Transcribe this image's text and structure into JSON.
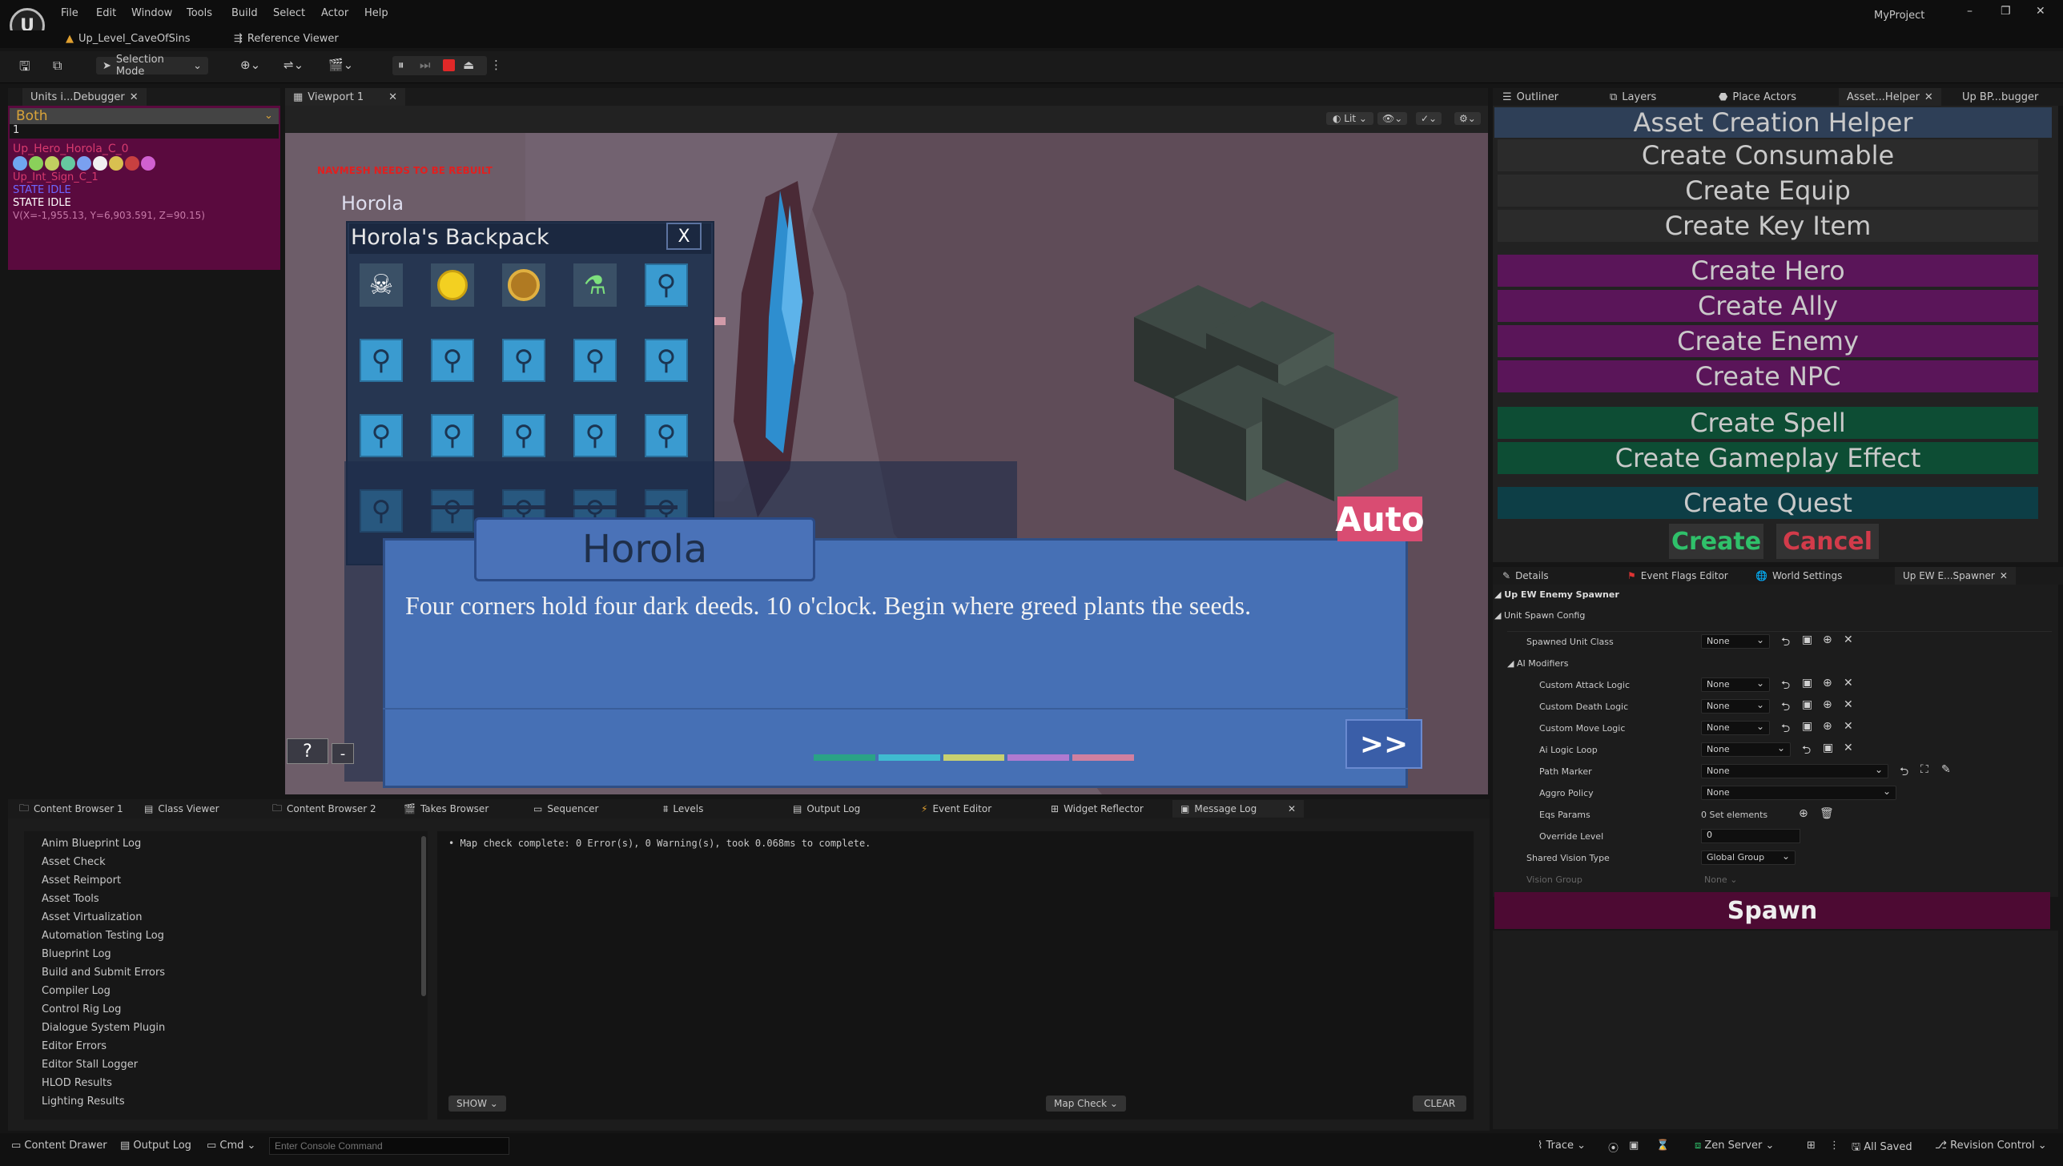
{
  "window": {
    "menu": [
      "File",
      "Edit",
      "Window",
      "Tools",
      "Build",
      "Select",
      "Actor",
      "Help"
    ],
    "project": "MyProject",
    "level_tab": "Up_Level_CaveOfSins",
    "ref_tab": "Reference Viewer",
    "controls": [
      "–",
      "❐",
      "✕"
    ]
  },
  "toolbar": {
    "mode": "Selection Mode"
  },
  "left_panel": {
    "tab": "Units i...Debugger",
    "filter": "Both",
    "filter_line": "1",
    "lines": [
      {
        "text": "Up_Hero_Horola_C_0",
        "color": "#d73a6e"
      },
      {
        "text": "Up_Int_Sign_C_1",
        "color": "#d73a6e"
      },
      {
        "text": "STATE IDLE",
        "color": "#6e66ff"
      },
      {
        "text": "STATE IDLE",
        "color": "#ffffff"
      },
      {
        "text": "V(X=-1,955.13, Y=6,903.591, Z=90.15)",
        "color": "#c77aa8"
      }
    ]
  },
  "viewport": {
    "tab": "Viewport 1",
    "lit": "Lit",
    "navmesh_warning": "NAVMESH NEEDS TO BE REBUILT",
    "backpack_title": "Horola's Backpack",
    "close": "X",
    "hero_name_bg": "Horola",
    "dialogue_speaker": "Horola",
    "dialogue_text": "Four corners hold four dark deeds. 10 o'clock. Begin where greed plants the seeds.",
    "auto": "Auto",
    "next": ">>",
    "help": "?",
    "minus": "-"
  },
  "right_tabs": [
    "Outliner",
    "Layers",
    "Place Actors",
    "Asset...Helper",
    "Up BP...bugger"
  ],
  "asset_helper": {
    "title": "Asset Creation Helper",
    "buttons": [
      {
        "label": "Create Consumable",
        "color": "#2b2b2b"
      },
      {
        "label": "Create Equip",
        "color": "#2b2b2b"
      },
      {
        "label": "Create Key Item",
        "color": "#2b2b2b"
      },
      {
        "label": "Create Hero",
        "color": "#5a1559"
      },
      {
        "label": "Create Ally",
        "color": "#5a1559"
      },
      {
        "label": "Create Enemy",
        "color": "#5a1559"
      },
      {
        "label": "Create NPC",
        "color": "#5a1559"
      },
      {
        "label": "Create Spell",
        "color": "#0d4d34"
      },
      {
        "label": "Create Gameplay Effect",
        "color": "#0d4d34"
      },
      {
        "label": "Create Quest",
        "color": "#0d3e46"
      }
    ],
    "create": "Create",
    "cancel": "Cancel"
  },
  "details": {
    "tabs": [
      "Details",
      "Event Flags Editor",
      "World Settings",
      "Up EW E...Spawner"
    ],
    "header": "Up EW Enemy Spawner",
    "section": "Unit Spawn Config",
    "subsection": "AI Modifiers",
    "rows": [
      {
        "label": "Spawned Unit Class",
        "value": "None"
      },
      {
        "label": "Custom Attack Logic",
        "value": "None"
      },
      {
        "label": "Custom Death Logic",
        "value": "None"
      },
      {
        "label": "Custom Move Logic",
        "value": "None"
      },
      {
        "label": "Ai Logic Loop",
        "value": "None"
      },
      {
        "label": "Path Marker",
        "value": "None"
      },
      {
        "label": "Aggro Policy",
        "value": "None"
      },
      {
        "label": "Eqs Params",
        "value": "0 Set elements"
      },
      {
        "label": "Override Level",
        "value": "0"
      },
      {
        "label": "Shared Vision Type",
        "value": "Global Group"
      },
      {
        "label": "Vision Group",
        "value": "None"
      }
    ],
    "spawn": "Spawn"
  },
  "bottom_tabs": [
    "Content Browser 1",
    "Class Viewer",
    "Content Browser 2",
    "Takes Browser",
    "Sequencer",
    "Levels",
    "Output Log",
    "Event Editor",
    "Widget Reflector",
    "Message Log"
  ],
  "log_categories": [
    "Anim Blueprint Log",
    "Asset Check",
    "Asset Reimport",
    "Asset Tools",
    "Asset Virtualization",
    "Automation Testing Log",
    "Blueprint Log",
    "Build and Submit Errors",
    "Compiler Log",
    "Control Rig Log",
    "Dialogue System Plugin",
    "Editor Errors",
    "Editor Stall Logger",
    "HLOD Results",
    "Lighting Results"
  ],
  "log_message": "Map check complete: 0 Error(s), 0 Warning(s), took 0.068ms to complete.",
  "log_show": "SHOW",
  "log_mapcheck": "Map Check",
  "log_clear": "CLEAR",
  "statusbar": {
    "content_drawer": "Content Drawer",
    "output_log": "Output Log",
    "cmd": "Cmd",
    "console_placeholder": "Enter Console Command",
    "trace": "Trace",
    "zen": "Zen Server",
    "saved": "All Saved",
    "revision": "Revision Control"
  }
}
